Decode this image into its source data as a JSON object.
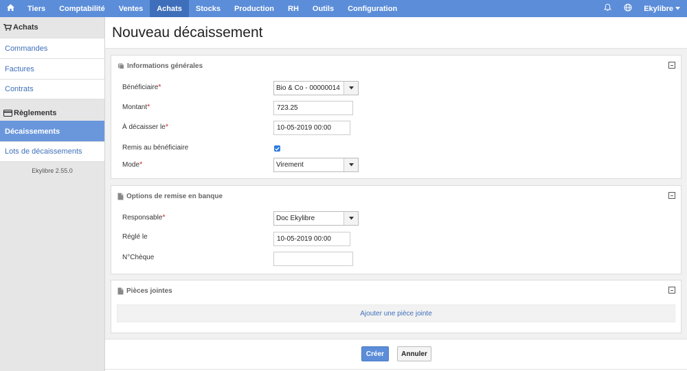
{
  "topnav": {
    "items": [
      {
        "label": "Tiers"
      },
      {
        "label": "Comptabilité"
      },
      {
        "label": "Ventes"
      },
      {
        "label": "Achats"
      },
      {
        "label": "Stocks"
      },
      {
        "label": "Production"
      },
      {
        "label": "RH"
      },
      {
        "label": "Outils"
      },
      {
        "label": "Configuration"
      }
    ],
    "active_item": "Achats",
    "user_menu_label": "Ekylibre",
    "icons": [
      "home-icon",
      "bell-icon",
      "globe-icon",
      "caret-down-icon"
    ],
    "bar_color": "#5b8dd9",
    "active_color": "#3f6fba"
  },
  "sidebar": {
    "section1": {
      "title": "Achats",
      "icon": "cart-icon",
      "links": [
        {
          "label": "Commandes"
        },
        {
          "label": "Factures"
        },
        {
          "label": "Contrats"
        }
      ]
    },
    "section2": {
      "title": "Règlements",
      "icon": "credit-card-icon",
      "links": [
        {
          "label": "Décaissements"
        },
        {
          "label": "Lots de décaissements"
        }
      ],
      "active_link": "Décaissements"
    },
    "version": "Ekylibre 2.55.0"
  },
  "page": {
    "title": "Nouveau décaissement"
  },
  "general_panel": {
    "title": "Informations générales",
    "icon": "book-icon",
    "fields": {
      "beneficiaire": {
        "label": "Bénéficiaire",
        "required_mark": "*",
        "value": "Bio & Co - 00000014"
      },
      "montant": {
        "label": "Montant",
        "required_mark": "*",
        "value": "723.25"
      },
      "date": {
        "label": "À décaisser le",
        "required_mark": "*",
        "value": "10-05-2019 00:00"
      },
      "remis": {
        "label": "Remis au bénéficiaire",
        "checked": true
      },
      "mode": {
        "label": "Mode",
        "required_mark": "*",
        "value": "Virement"
      }
    }
  },
  "bank_panel": {
    "title": "Options de remise en banque",
    "icon": "file-icon",
    "fields": {
      "responsable": {
        "label": "Responsable",
        "required_mark": "*",
        "value": "Doc Ekylibre"
      },
      "regle": {
        "label": "Réglé le",
        "value": "10-05-2019 00:00"
      },
      "cheque": {
        "label": "N°Chèque",
        "value": ""
      }
    }
  },
  "attachments_panel": {
    "title": "Pièces jointes",
    "icon": "file-icon",
    "add_link": "Ajouter une pièce jointe"
  },
  "actions": {
    "create_label": "Créer",
    "cancel_label": "Annuler"
  }
}
